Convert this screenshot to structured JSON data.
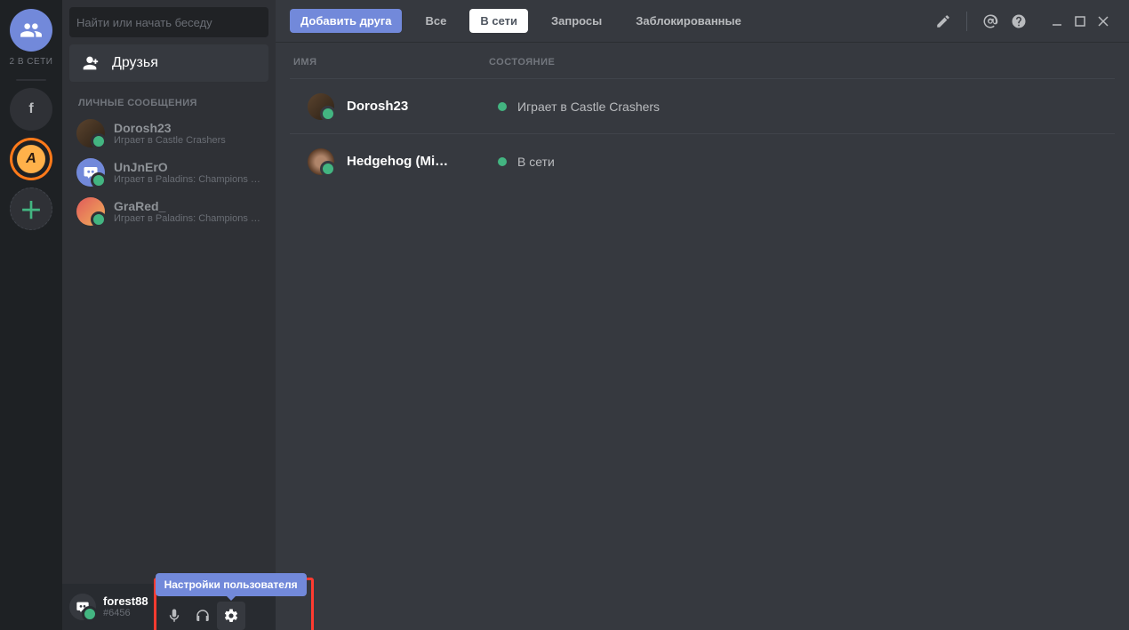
{
  "rail": {
    "online_label": "2 В СЕТИ",
    "server_f_letter": "f",
    "server_a_letter": "A"
  },
  "sidebar": {
    "search_placeholder": "Найти или начать беседу",
    "friends_label": "Друзья",
    "dm_header": "ЛИЧНЫЕ СООБЩЕНИЯ",
    "dm": [
      {
        "name": "Dorosh23",
        "sub": "Играет в Castle Crashers"
      },
      {
        "name": "UnJnErO",
        "sub": "Играет в Paladins: Champions of th…"
      },
      {
        "name": "GraRed_",
        "sub": "Играет в Paladins: Champions of th…"
      }
    ]
  },
  "user": {
    "name": "forest88",
    "tag": "#6456",
    "tooltip": "Настройки пользователя"
  },
  "topbar": {
    "add_friend": "Добавить друга",
    "tabs": {
      "all": "Все",
      "online": "В сети",
      "pending": "Запросы",
      "blocked": "Заблокированные"
    }
  },
  "columns": {
    "name": "ИМЯ",
    "status": "СОСТОЯНИЕ"
  },
  "friends": [
    {
      "name": "Dorosh23",
      "status": "Играет в Castle Crashers"
    },
    {
      "name": "Hedgehog (Mi…",
      "status": "В сети"
    }
  ]
}
